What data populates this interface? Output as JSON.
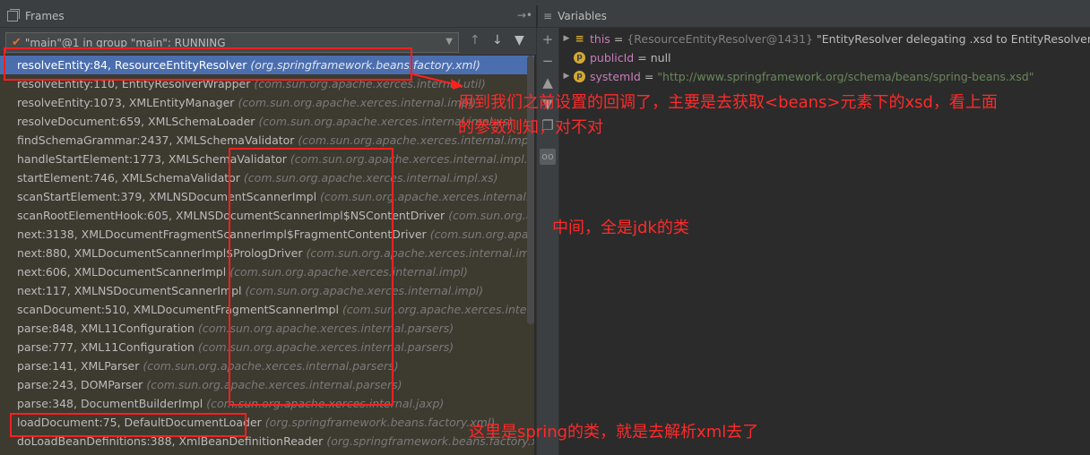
{
  "frames_panel": {
    "title": "Frames",
    "thread": "\"main\"@1 in group \"main\": RUNNING",
    "items": [
      {
        "method": "resolveEntity:84, ResourceEntityResolver",
        "pkg": "(org.springframework.beans.factory.xml)"
      },
      {
        "method": "resolveEntity:110, EntityResolverWrapper",
        "pkg": "(com.sun.org.apache.xerces.internal.util)"
      },
      {
        "method": "resolveEntity:1073, XMLEntityManager",
        "pkg": "(com.sun.org.apache.xerces.internal.impl)"
      },
      {
        "method": "resolveDocument:659, XMLSchemaLoader",
        "pkg": "(com.sun.org.apache.xerces.internal.impl.xs)"
      },
      {
        "method": "findSchemaGrammar:2437, XMLSchemaValidator",
        "pkg": "(com.sun.org.apache.xerces.internal.impl.xs)"
      },
      {
        "method": "handleStartElement:1773, XMLSchemaValidator",
        "pkg": "(com.sun.org.apache.xerces.internal.impl.xs)"
      },
      {
        "method": "startElement:746, XMLSchemaValidator",
        "pkg": "(com.sun.org.apache.xerces.internal.impl.xs)"
      },
      {
        "method": "scanStartElement:379, XMLNSDocumentScannerImpl",
        "pkg": "(com.sun.org.apache.xerces.internal.impl)"
      },
      {
        "method": "scanRootElementHook:605, XMLNSDocumentScannerImpl$NSContentDriver",
        "pkg": "(com.sun.org.apache.xe"
      },
      {
        "method": "next:3138, XMLDocumentFragmentScannerImpl$FragmentContentDriver",
        "pkg": "(com.sun.org.apache.xerces"
      },
      {
        "method": "next:880, XMLDocumentScannerImpl$PrologDriver",
        "pkg": "(com.sun.org.apache.xerces.internal.impl)"
      },
      {
        "method": "next:606, XMLDocumentScannerImpl",
        "pkg": "(com.sun.org.apache.xerces.internal.impl)"
      },
      {
        "method": "next:117, XMLNSDocumentScannerImpl",
        "pkg": "(com.sun.org.apache.xerces.internal.impl)"
      },
      {
        "method": "scanDocument:510, XMLDocumentFragmentScannerImpl",
        "pkg": "(com.sun.org.apache.xerces.internal.impl)"
      },
      {
        "method": "parse:848, XML11Configuration",
        "pkg": "(com.sun.org.apache.xerces.internal.parsers)"
      },
      {
        "method": "parse:777, XML11Configuration",
        "pkg": "(com.sun.org.apache.xerces.internal.parsers)"
      },
      {
        "method": "parse:141, XMLParser",
        "pkg": "(com.sun.org.apache.xerces.internal.parsers)"
      },
      {
        "method": "parse:243, DOMParser",
        "pkg": "(com.sun.org.apache.xerces.internal.parsers)"
      },
      {
        "method": "parse:348, DocumentBuilderImpl",
        "pkg": "(com.sun.org.apache.xerces.internal.jaxp)"
      },
      {
        "method": "loadDocument:75, DefaultDocumentLoader",
        "pkg": "(org.springframework.beans.factory.xml)"
      },
      {
        "method": "doLoadBeanDefinitions:388, XmlBeanDefinitionReader",
        "pkg": "(org.springframework.beans.factory.xml)"
      }
    ]
  },
  "variables_panel": {
    "title": "Variables",
    "rows": [
      {
        "name": "this",
        "type": "{ResourceEntityResolver@1431}",
        "text": "\"EntityResolver delegating .xsd to EntityResolver using m"
      },
      {
        "name": "publicId",
        "value": "null"
      },
      {
        "name": "systemId",
        "value": "\"http://www.springframework.org/schema/beans/spring-beans.xsd\""
      }
    ]
  },
  "annotations": {
    "callback": "用到我们之前设置的回调了，主要是去获取<beans>元素下的xsd，看上面",
    "callback2": "的参数则知，对不对",
    "middle": "中间，全是jdk的类",
    "spring": "这里是spring的类，就是去解析xml去了"
  },
  "colors": {
    "selection": "#4b6eaf",
    "annotation": "#ff2020"
  }
}
